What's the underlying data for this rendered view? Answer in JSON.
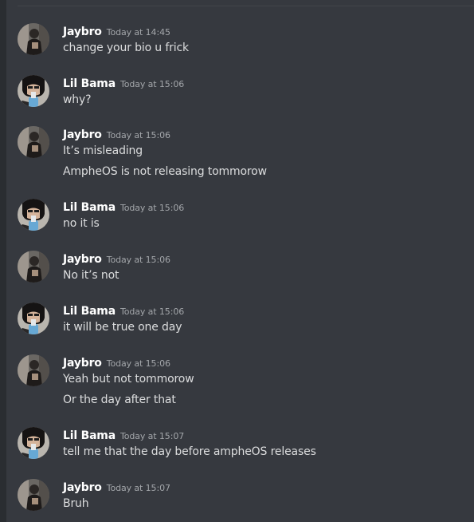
{
  "messages": [
    {
      "author": "Jaybro",
      "timestamp": "Today at 14:45",
      "lines": [
        "change your bio u frick"
      ]
    },
    {
      "author": "Lil Bama",
      "timestamp": "Today at 15:06",
      "lines": [
        "why?"
      ]
    },
    {
      "author": "Jaybro",
      "timestamp": "Today at 15:06",
      "lines": [
        "It’s misleading",
        "AmpheOS is not releasing tommorow"
      ]
    },
    {
      "author": "Lil Bama",
      "timestamp": "Today at 15:06",
      "lines": [
        "no it is"
      ]
    },
    {
      "author": "Jaybro",
      "timestamp": "Today at 15:06",
      "lines": [
        "No it’s not"
      ]
    },
    {
      "author": "Lil Bama",
      "timestamp": "Today at 15:06",
      "lines": [
        "it will be true one day"
      ]
    },
    {
      "author": "Jaybro",
      "timestamp": "Today at 15:06",
      "lines": [
        "Yeah but not tommorow",
        "Or the day after that"
      ]
    },
    {
      "author": "Lil Bama",
      "timestamp": "Today at 15:07",
      "lines": [
        "tell me that the day before ampheOS releases"
      ]
    },
    {
      "author": "Jaybro",
      "timestamp": "Today at 15:07",
      "lines": [
        "Bruh"
      ]
    }
  ]
}
